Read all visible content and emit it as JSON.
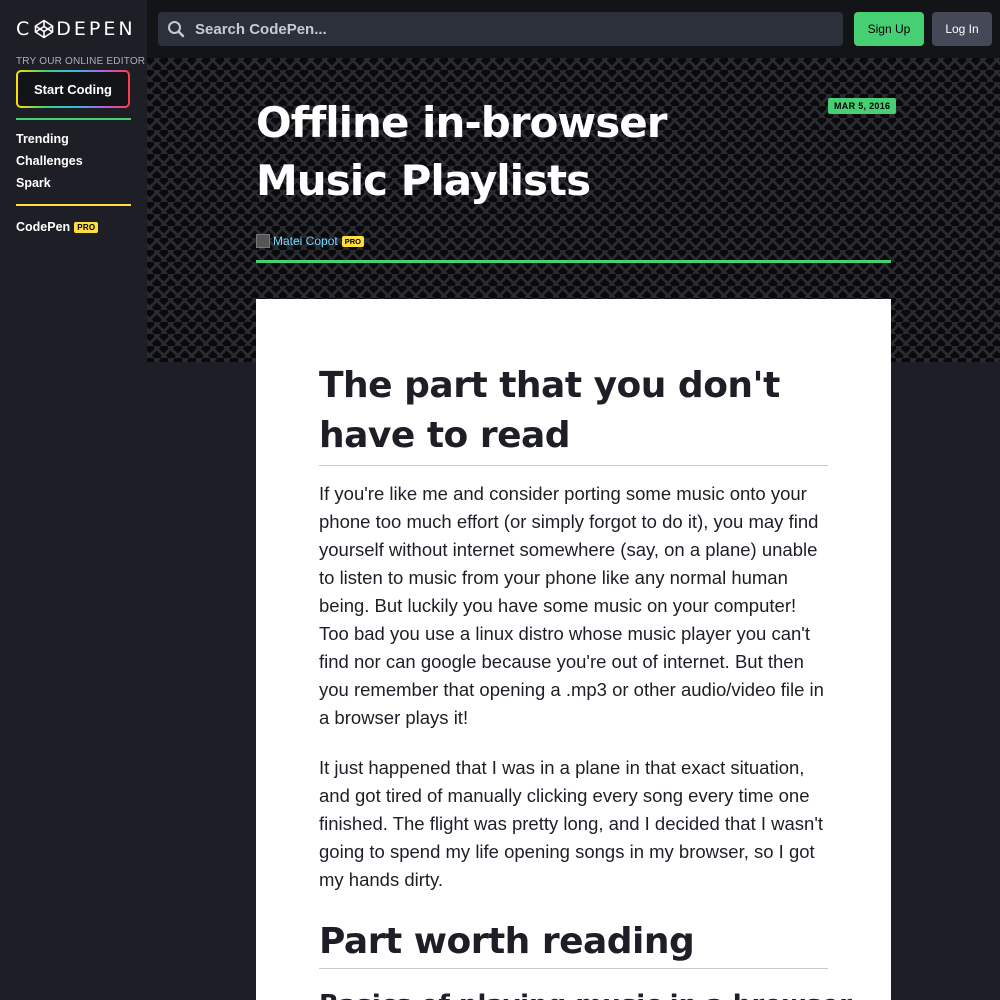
{
  "brand": {
    "logo_text_left": "C",
    "logo_text_right": "DEPEN"
  },
  "sidebar": {
    "try_label": "TRY OUR ONLINE EDITOR",
    "start_coding": "Start Coding",
    "nav": [
      "Trending",
      "Challenges",
      "Spark"
    ],
    "codepen_label": "CodePen",
    "pro_badge": "PRO"
  },
  "header": {
    "search_placeholder": "Search CodePen...",
    "signup_label": "Sign Up",
    "login_label": "Log In"
  },
  "post": {
    "date": "MAR 5, 2016",
    "title": "Offline in-browser Music Playlists",
    "author_name": "Matei Copot",
    "author_badge": "PRO"
  },
  "article": {
    "heading_1": "The part that you don't have to read",
    "paragraphs": [
      "If you're like me and consider porting some music onto your phone too much effort (or simply forgot to do it), you may find yourself without internet somewhere (say, on a plane) unable to listen to music from your phone like any normal human being. But luckily you have some music on your computer! Too bad you use a linux distro whose music player you can't find nor can google because you're out of internet. But then you remember that opening a .mp3 or other audio/video file in a browser plays it!",
      "It just happened that I was in a plane in that exact situation, and got tired of manually clicking every song every time one finished. The flight was pretty long, and I decided that I wasn't going to spend my life opening songs in my browser, so I got my hands dirty."
    ],
    "heading_2": "Part worth reading",
    "heading_3": "Basics of playing music in a browser"
  },
  "colors": {
    "accent_green": "#47cf73",
    "accent_yellow": "#ffdd40",
    "link_blue": "#76daff",
    "header_bg": "#131417",
    "sidebar_bg": "#1e1f26"
  },
  "icons": {
    "search": "search-icon",
    "logo": "codepen-logo-icon"
  }
}
